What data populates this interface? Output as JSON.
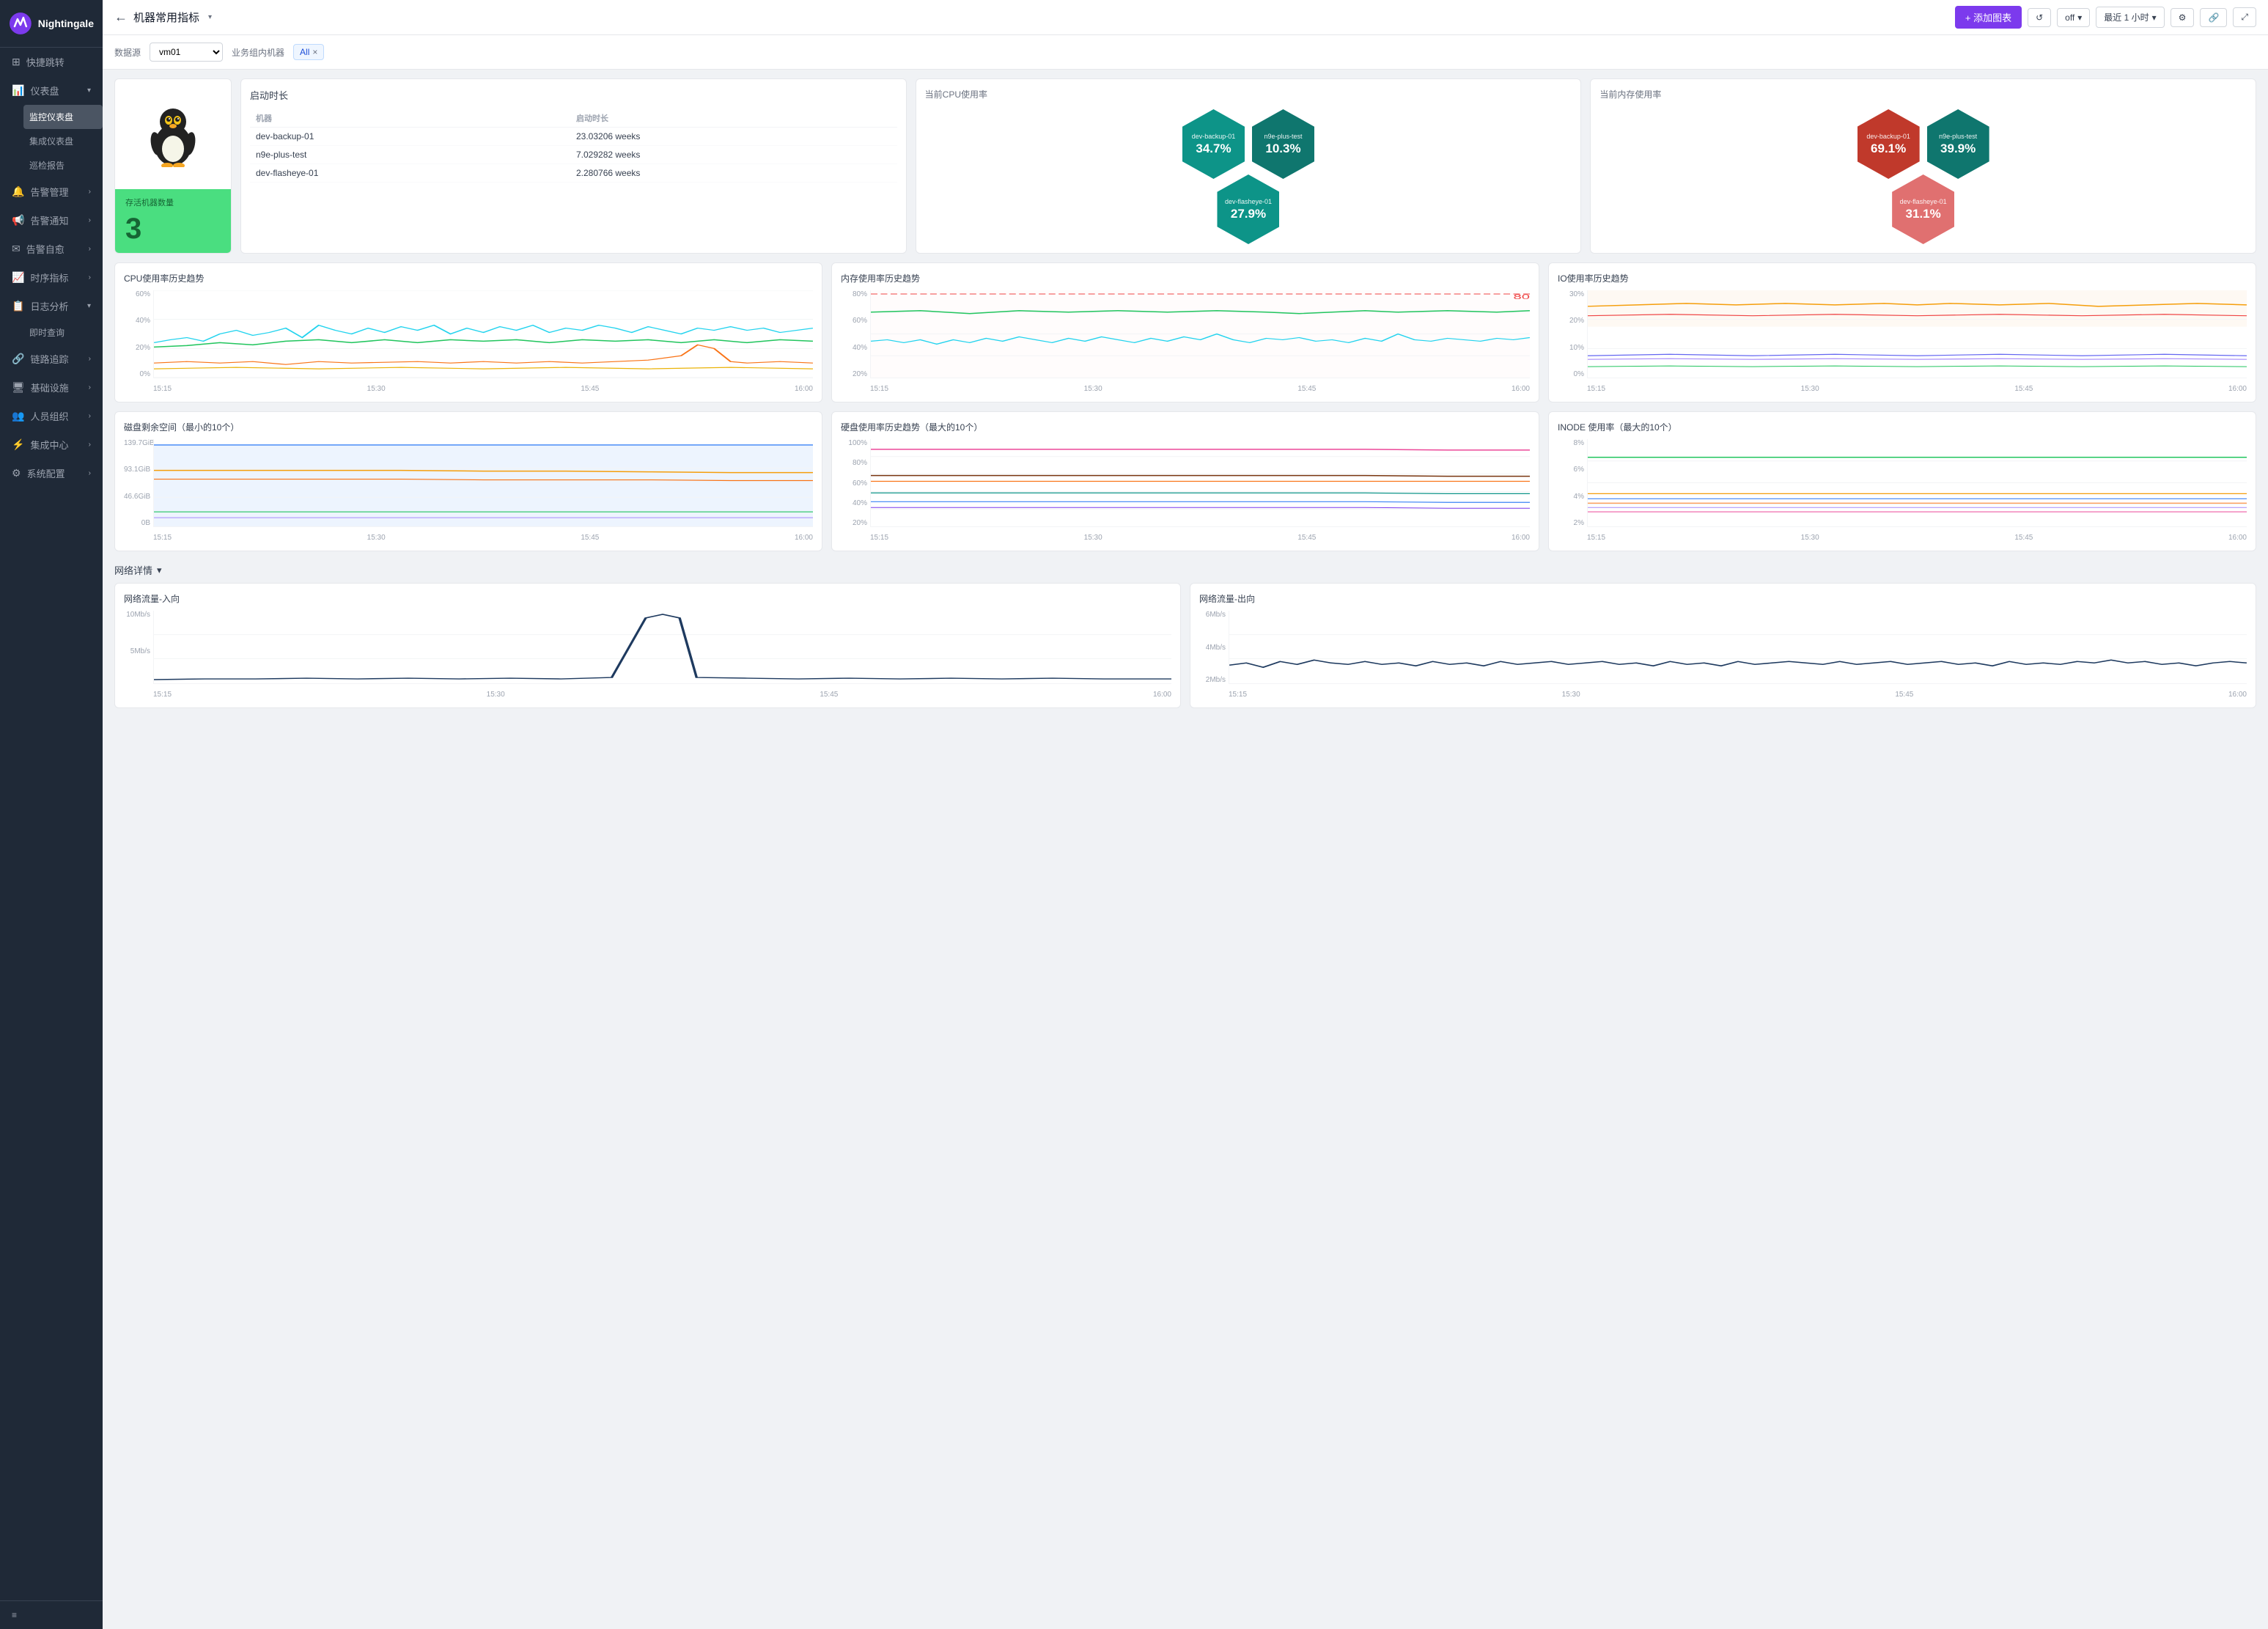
{
  "app": {
    "name": "Nightingale"
  },
  "sidebar": {
    "logo_text": "Nightingale",
    "items": [
      {
        "id": "quick-jump",
        "label": "快捷跳转",
        "icon": "⊞",
        "has_arrow": false
      },
      {
        "id": "dashboard",
        "label": "仪表盘",
        "icon": "📊",
        "has_arrow": true,
        "expanded": true,
        "sub": [
          {
            "id": "monitor-dashboard",
            "label": "监控仪表盘",
            "active": true
          },
          {
            "id": "integrated-dashboard",
            "label": "集成仪表盘"
          },
          {
            "id": "inspection-report",
            "label": "巡检报告"
          }
        ]
      },
      {
        "id": "alert-mgmt",
        "label": "告警管理",
        "icon": "🔔",
        "has_arrow": true
      },
      {
        "id": "alert-notify",
        "label": "告警通知",
        "icon": "📢",
        "has_arrow": true
      },
      {
        "id": "alert-self",
        "label": "告警自愈",
        "icon": "✉",
        "has_arrow": true
      },
      {
        "id": "time-metrics",
        "label": "时序指标",
        "icon": "📈",
        "has_arrow": true
      },
      {
        "id": "log-analysis",
        "label": "日志分析",
        "icon": "📋",
        "has_arrow": true,
        "sub": [
          {
            "id": "realtime-query",
            "label": "即时查询"
          }
        ]
      },
      {
        "id": "trace",
        "label": "链路追踪",
        "icon": "🔗",
        "has_arrow": true
      },
      {
        "id": "infra",
        "label": "基础设施",
        "icon": "🖥",
        "has_arrow": true
      },
      {
        "id": "personnel",
        "label": "人员组织",
        "icon": "👥",
        "has_arrow": true
      },
      {
        "id": "integration",
        "label": "集成中心",
        "icon": "⚙",
        "has_arrow": true
      },
      {
        "id": "sys-config",
        "label": "系统配置",
        "icon": "⚙",
        "has_arrow": true
      }
    ],
    "bottom_icon": "≡"
  },
  "topbar": {
    "back_icon": "←",
    "title": "机器常用指标",
    "dropdown_icon": "▾",
    "add_button": "+ 添加图表",
    "refresh_icon": "↺",
    "off_label": "off",
    "time_label": "最近 1 小时",
    "settings_icon": "⚙",
    "share_icon": "🔗",
    "expand_icon": "⤢"
  },
  "filterbar": {
    "datasource_label": "数据源",
    "datasource_value": "vm01",
    "group_label": "业务组内机器",
    "group_tag": "All",
    "group_tag_close": "×"
  },
  "uptime_table": {
    "title": "启动时长",
    "col_machine": "机器",
    "col_uptime": "启动时长",
    "rows": [
      {
        "machine": "dev-backup-01",
        "uptime": "23.03206 weeks"
      },
      {
        "machine": "n9e-plus-test",
        "uptime": "7.029282 weeks"
      },
      {
        "machine": "dev-flasheye-01",
        "uptime": "2.280766 weeks"
      }
    ]
  },
  "active_machines": {
    "label": "存活机器数量",
    "count": "3"
  },
  "cpu_usage": {
    "title": "当前CPU使用率",
    "items": [
      {
        "name": "dev-backup-01",
        "value": "34.7%",
        "color": "teal"
      },
      {
        "name": "n9e-plus-test",
        "value": "10.3%",
        "color": "teal2"
      },
      {
        "name": "dev-flasheye-01",
        "value": "27.9%",
        "color": "teal"
      }
    ]
  },
  "mem_usage": {
    "title": "当前内存使用率",
    "items": [
      {
        "name": "dev-backup-01",
        "value": "69.1%",
        "color": "salmon"
      },
      {
        "name": "n9e-plus-test",
        "value": "39.9%",
        "color": "teal2"
      },
      {
        "name": "dev-flasheye-01",
        "value": "31.1%",
        "color": "salmon2"
      }
    ]
  },
  "charts": {
    "cpu_history": {
      "title": "CPU使用率历史趋势",
      "ymax": "60%",
      "ymid": "40%",
      "ylow": "20%",
      "y0": "0%",
      "x_labels": [
        "15:15",
        "15:30",
        "15:45",
        "16:00"
      ]
    },
    "mem_history": {
      "title": "内存使用率历史趋势",
      "ymax": "80%",
      "ymid": "60%",
      "ylow": "40%",
      "y2": "20%",
      "threshold": "80",
      "x_labels": [
        "15:15",
        "15:30",
        "15:45",
        "16:00"
      ]
    },
    "io_history": {
      "title": "IO使用率历史趋势",
      "ymax": "30%",
      "ymid": "20%",
      "ylow": "10%",
      "y0": "0%",
      "x_labels": [
        "15:15",
        "15:30",
        "15:45",
        "16:00"
      ]
    },
    "disk_space": {
      "title": "磁盘剩余空间（最小的10个）",
      "y1": "139.7GiB",
      "y2": "93.1GiB",
      "y3": "46.6GiB",
      "y4": "0B",
      "x_labels": [
        "15:15",
        "15:30",
        "15:45",
        "16:00"
      ]
    },
    "disk_usage": {
      "title": "硬盘使用率历史趋势（最大的10个）",
      "ymax": "100%",
      "ymid": "80%",
      "y3": "60%",
      "y4": "40%",
      "y5": "20%",
      "x_labels": [
        "15:15",
        "15:30",
        "15:45",
        "16:00"
      ]
    },
    "inode": {
      "title": "INODE 使用率（最大的10个）",
      "ymax": "8%",
      "ymid": "6%",
      "y3": "4%",
      "y4": "2%",
      "x_labels": [
        "15:15",
        "15:30",
        "15:45",
        "16:00"
      ]
    }
  },
  "network": {
    "title": "网络详情",
    "dropdown_icon": "▾",
    "inbound": {
      "title": "网络流量-入向",
      "y1": "10Mb/s",
      "y2": "5Mb/s"
    },
    "outbound": {
      "title": "网络流量-出向",
      "y1": "6Mb/s",
      "y2": "4Mb/s",
      "y3": "2Mb/s"
    }
  }
}
